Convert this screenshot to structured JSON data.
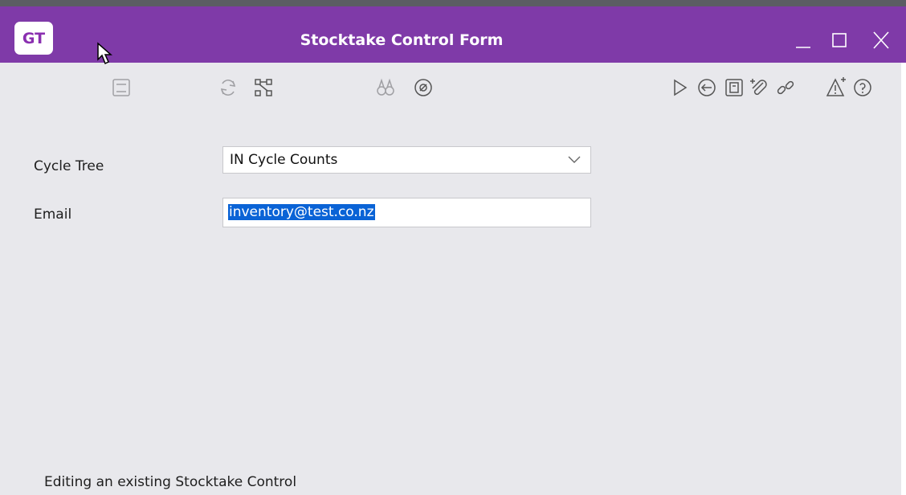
{
  "window": {
    "logo_text": "GT",
    "title": "Stocktake Control Form",
    "controls": [
      "minimize-icon",
      "maximize-icon",
      "close-icon"
    ]
  },
  "toolbar": {
    "icons": [
      "save-icon",
      "refresh-icon",
      "tree-icon",
      "find-icon",
      "compass-icon",
      "play-icon",
      "back-icon",
      "document-icon",
      "attach-icon",
      "link-icon",
      "alert-icon",
      "help-icon"
    ]
  },
  "form": {
    "cycle_tree_label": "Cycle Tree",
    "cycle_tree_value": "IN Cycle Counts",
    "email_label": "Email",
    "email_value": "inventory@test.co.nz"
  },
  "status": {
    "text": "Editing an existing Stocktake Control"
  },
  "colors": {
    "titlebar": "#7f3aa8",
    "background": "#e8e8ec",
    "selection": "#0a63d6"
  }
}
